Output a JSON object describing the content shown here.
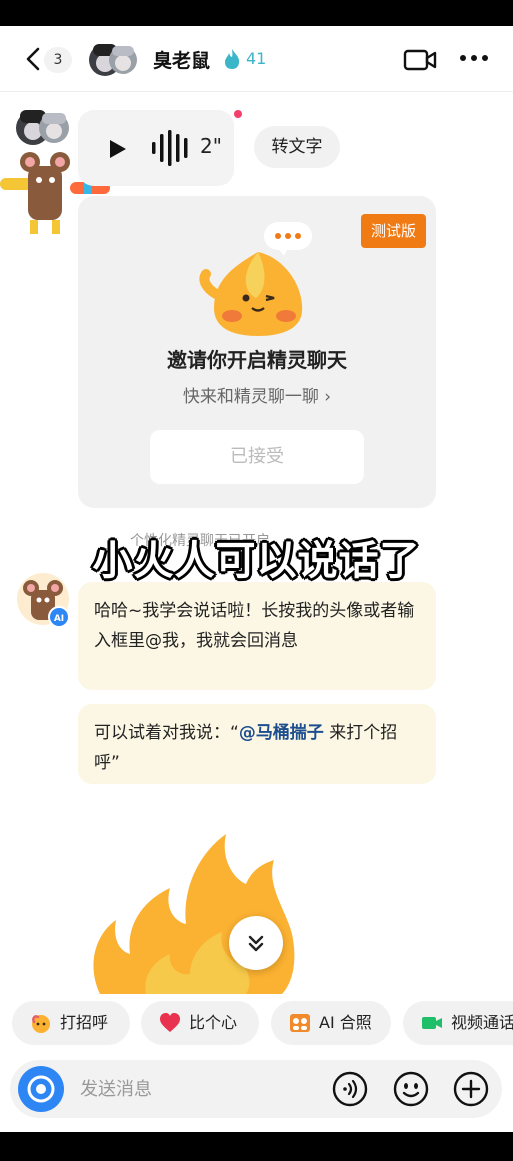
{
  "header": {
    "unread_count": "3",
    "contact_name": "臭老鼠",
    "spark_count": "41"
  },
  "chat": {
    "voice": {
      "duration": "2\"",
      "to_text_label": "转文字"
    },
    "invite_card": {
      "badge": "测试版",
      "title": "邀请你开启精灵聊天",
      "subtitle": "快来和精灵聊一聊 ›",
      "accepted_label": "已接受"
    },
    "hint": "个性化精灵聊天已开启",
    "overlay_caption": "小火人可以说话了",
    "ai_badge": "AI",
    "message1": "哈哈~我学会说话啦！长按我的头像或者输入框里@我，我就会回消息",
    "message2_prefix": "可以试着对我说：“",
    "message2_mention": "@马桶揣子",
    "message2_suffix": " 来打个招呼”"
  },
  "quick_actions": [
    {
      "label": "打招呼",
      "icon": "wave-hand-icon"
    },
    {
      "label": "比个心",
      "icon": "heart-icon"
    },
    {
      "label": "AI 合照",
      "icon": "photo-icon"
    },
    {
      "label": "视频通话",
      "icon": "video-call-icon"
    }
  ],
  "input": {
    "placeholder": "发送消息"
  },
  "colors": {
    "accent_blue": "#2e86f5",
    "beta_orange": "#f07a14",
    "bubble_bg": "#fbf7e4",
    "mention_blue": "#1d4e8f"
  }
}
